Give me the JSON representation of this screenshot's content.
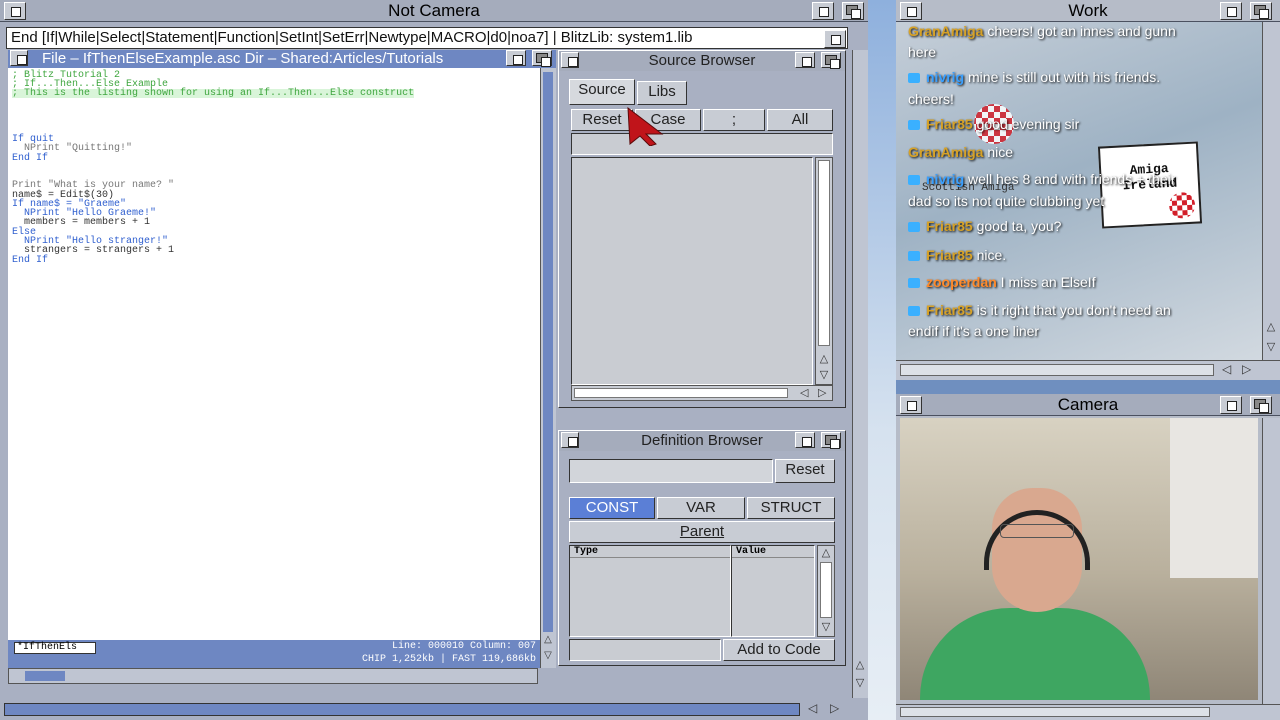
{
  "main_window": {
    "title": "Not Camera"
  },
  "menu_strip": {
    "text": "End [If|While|Select|Statement|Function|SetInt|SetErr|Newtype|MACRO|d0|noa7] | BlitzLib: system1.lib"
  },
  "editor": {
    "title": "File – IfThenElseExample.asc  Dir – Shared:Articles/Tutorials",
    "code_lines": [
      "; Blitz Tutorial 2",
      "; If...Then...Else Example",
      "; This is the listing shown for using an If...Then...Else construct",
      "If quit",
      "  NPrint \"Quitting!\"",
      "End If",
      "Print \"What is your name? \"",
      "name$ = Edit$(30)",
      "If name$ = \"Graeme\"",
      "  NPrint \"Hello Graeme!\"",
      "  members = members + 1",
      "Else",
      "  NPrint \"Hello stranger!\"",
      "  strangers = strangers + 1",
      "End If"
    ],
    "tab_name": "*IfThenEls",
    "status_line": "Line: 000010 Column: 007",
    "status_mem": "CHIP 1,252kb | FAST 119,686kb"
  },
  "source_browser": {
    "title": "Source Browser",
    "tabs": [
      "Source",
      "Libs"
    ],
    "buttons": [
      "Reset",
      "Case",
      ";",
      "All"
    ]
  },
  "definition_browser": {
    "title": "Definition Browser",
    "reset_label": "Reset",
    "type_buttons": [
      "CONST",
      "VAR",
      "STRUCT"
    ],
    "parent_label": "Parent",
    "col_type": "Type",
    "col_value": "Value",
    "add_label": "Add to Code"
  },
  "work_window": {
    "title": "Work",
    "chat": [
      {
        "user": "GranAmiga",
        "color": "gold",
        "text": "cheers! got an innes and gunn"
      },
      {
        "user": "",
        "color": "",
        "text": "here"
      },
      {
        "user": "nivrig",
        "color": "blue",
        "text": "mine is still out with his friends."
      },
      {
        "user": "",
        "color": "",
        "text": "cheers!"
      },
      {
        "user": "Friar85",
        "color": "gold",
        "text": "good evening sir"
      },
      {
        "user": "GranAmiga",
        "color": "gold",
        "text": "nice"
      },
      {
        "user": "nivrig",
        "color": "blue",
        "text": "well hes 8 and with friends + their"
      },
      {
        "user": "",
        "color": "",
        "text": "dad so its not quite clubbing yet"
      },
      {
        "user": "Friar85",
        "color": "gold",
        "text": "good ta, you?"
      },
      {
        "user": "Friar85",
        "color": "gold",
        "text": "nice."
      },
      {
        "user": "zooperdan",
        "color": "orange",
        "text": "I miss an ElseIf"
      },
      {
        "user": "Friar85",
        "color": "gold",
        "text": "is it right that you don't need an"
      },
      {
        "user": "",
        "color": "",
        "text": "endif if it's a one liner"
      }
    ],
    "logo_text": "Amiga Ireland",
    "logo_sub": "Scottish Amiga"
  },
  "camera_window": {
    "title": "Camera"
  },
  "colors": {
    "accent": "#6e87c2",
    "selected": "#5b7fd6",
    "workbench_grey": "#a9b0c2"
  }
}
